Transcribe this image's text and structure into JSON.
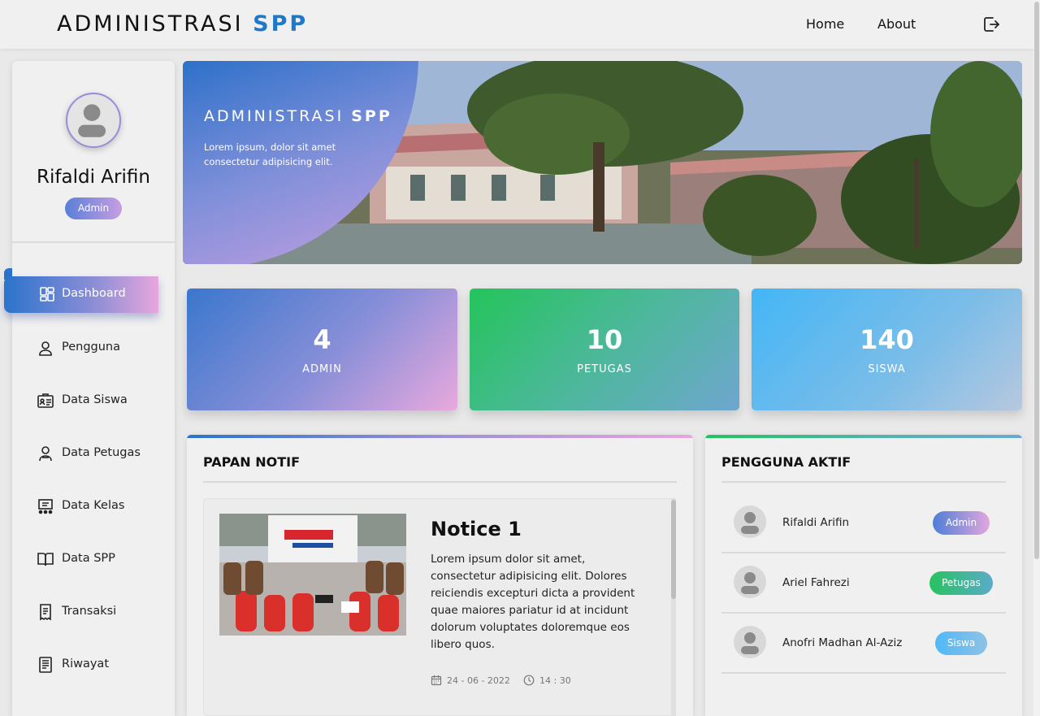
{
  "header": {
    "brand_main": "ADMINISTRASI",
    "brand_accent": "SPP",
    "nav": [
      {
        "label": "Home"
      },
      {
        "label": "About"
      }
    ],
    "logout_icon": "logout-icon"
  },
  "sidebar": {
    "user_name": "Rifaldi Arifin",
    "user_role": "Admin",
    "items": [
      {
        "label": "Dashboard",
        "icon": "dashboard-icon",
        "active": true
      },
      {
        "label": "Pengguna",
        "icon": "user-icon"
      },
      {
        "label": "Data Siswa",
        "icon": "id-card-icon"
      },
      {
        "label": "Data Petugas",
        "icon": "staff-icon"
      },
      {
        "label": "Data Kelas",
        "icon": "classroom-icon"
      },
      {
        "label": "Data SPP",
        "icon": "book-icon"
      },
      {
        "label": "Transaksi",
        "icon": "receipt-icon"
      },
      {
        "label": "Riwayat",
        "icon": "history-icon"
      }
    ]
  },
  "hero": {
    "title_main": "ADMINISTRASI",
    "title_accent": "SPP",
    "subtitle": "Lorem ipsum, dolor sit amet consectetur adipisicing elit."
  },
  "stats": [
    {
      "value": "4",
      "label": "ADMIN"
    },
    {
      "value": "10",
      "label": "PETUGAS"
    },
    {
      "value": "140",
      "label": "SISWA"
    }
  ],
  "notif_panel": {
    "title": "PAPAN NOTIF",
    "notices": [
      {
        "title": "Notice 1",
        "body": "Lorem ipsum dolor sit amet, consectetur adipisicing elit. Dolores reiciendis excepturi dicta a provident quae maiores pariatur id at incidunt dolorum voluptates doloremque eos libero quos.",
        "date": "24 - 06 - 2022",
        "time": "14 : 30"
      }
    ]
  },
  "users_panel": {
    "title": "PENGGUNA AKTIF",
    "users": [
      {
        "name": "Rifaldi Arifin",
        "role": "Admin",
        "color": "#7c8fd8"
      },
      {
        "name": "Ariel Fahrezi",
        "role": "Petugas",
        "color": "#33bf7e"
      },
      {
        "name": "Anofri Madhan Al-Aziz",
        "role": "Siswa",
        "color": "#6cc3f0"
      }
    ]
  }
}
